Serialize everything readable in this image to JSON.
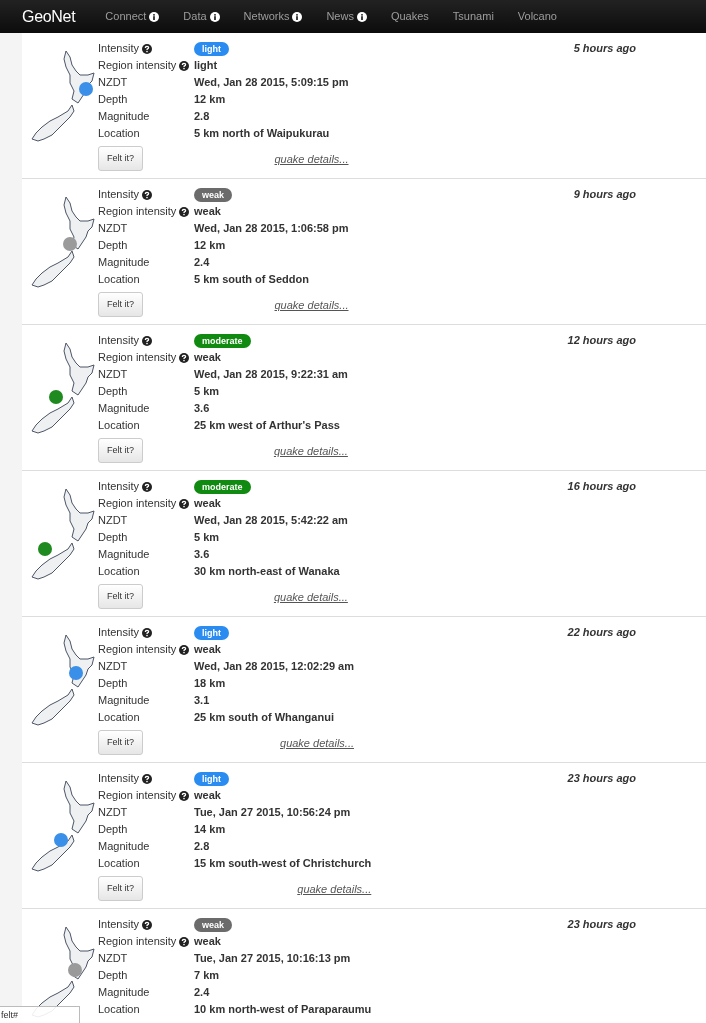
{
  "navbar": {
    "brand": "GeoNet",
    "items": [
      {
        "label": "Connect",
        "info": true
      },
      {
        "label": "Data",
        "info": true
      },
      {
        "label": "Networks",
        "info": true
      },
      {
        "label": "News",
        "info": true
      },
      {
        "label": "Quakes",
        "info": false
      },
      {
        "label": "Tsunami",
        "info": false
      },
      {
        "label": "Volcano",
        "info": false
      }
    ]
  },
  "quakes": [
    {
      "time_ago": "5 hours ago",
      "marker": {
        "color": "#3a8fe8"
      },
      "fields": [
        {
          "label": "Intensity",
          "help": true,
          "kind": "badge",
          "value": "light",
          "color": "#2a8cf0"
        },
        {
          "label": "Region intensity",
          "help": true,
          "kind": "text",
          "value": "light"
        },
        {
          "label": "NZDT",
          "help": false,
          "kind": "text",
          "value": "Wed, Jan 28 2015, 5:09:15 pm"
        },
        {
          "label": "Depth",
          "help": false,
          "kind": "text",
          "value": "12 km"
        },
        {
          "label": "Magnitude",
          "help": false,
          "kind": "text",
          "value": "2.8"
        },
        {
          "label": "Location",
          "help": false,
          "kind": "text",
          "value": "5 km north of Waipukurau"
        }
      ],
      "felt_button": "Felt it?",
      "details_link": "quake details..."
    },
    {
      "time_ago": "9 hours ago",
      "marker": {
        "color": "#9a9a9a"
      },
      "fields": [
        {
          "label": "Intensity",
          "help": true,
          "kind": "badge",
          "value": "weak",
          "color": "#6b6b6b"
        },
        {
          "label": "Region intensity",
          "help": true,
          "kind": "text",
          "value": "weak"
        },
        {
          "label": "NZDT",
          "help": false,
          "kind": "text",
          "value": "Wed, Jan 28 2015, 1:06:58 pm"
        },
        {
          "label": "Depth",
          "help": false,
          "kind": "text",
          "value": "12 km"
        },
        {
          "label": "Magnitude",
          "help": false,
          "kind": "text",
          "value": "2.4"
        },
        {
          "label": "Location",
          "help": false,
          "kind": "text",
          "value": "5 km south of Seddon"
        }
      ],
      "felt_button": "Felt it?",
      "details_link": "quake details..."
    },
    {
      "time_ago": "12 hours ago",
      "marker": {
        "color": "#1f8a1f"
      },
      "fields": [
        {
          "label": "Intensity",
          "help": true,
          "kind": "badge",
          "value": "moderate",
          "color": "#108a10"
        },
        {
          "label": "Region intensity",
          "help": true,
          "kind": "text",
          "value": "weak"
        },
        {
          "label": "NZDT",
          "help": false,
          "kind": "text",
          "value": "Wed, Jan 28 2015, 9:22:31 am"
        },
        {
          "label": "Depth",
          "help": false,
          "kind": "text",
          "value": "5 km"
        },
        {
          "label": "Magnitude",
          "help": false,
          "kind": "text",
          "value": "3.6"
        },
        {
          "label": "Location",
          "help": false,
          "kind": "text",
          "value": "25 km west of Arthur's Pass"
        }
      ],
      "felt_button": "Felt it?",
      "details_link": "quake details..."
    },
    {
      "time_ago": "16 hours ago",
      "marker": {
        "color": "#1f8a1f"
      },
      "fields": [
        {
          "label": "Intensity",
          "help": true,
          "kind": "badge",
          "value": "moderate",
          "color": "#108a10"
        },
        {
          "label": "Region intensity",
          "help": true,
          "kind": "text",
          "value": "weak"
        },
        {
          "label": "NZDT",
          "help": false,
          "kind": "text",
          "value": "Wed, Jan 28 2015, 5:42:22 am"
        },
        {
          "label": "Depth",
          "help": false,
          "kind": "text",
          "value": "5 km"
        },
        {
          "label": "Magnitude",
          "help": false,
          "kind": "text",
          "value": "3.6"
        },
        {
          "label": "Location",
          "help": false,
          "kind": "text",
          "value": "30 km north-east of Wanaka"
        }
      ],
      "felt_button": "Felt it?",
      "details_link": "quake details..."
    },
    {
      "time_ago": "22 hours ago",
      "marker": {
        "color": "#3a8fe8"
      },
      "fields": [
        {
          "label": "Intensity",
          "help": true,
          "kind": "badge",
          "value": "light",
          "color": "#2a8cf0"
        },
        {
          "label": "Region intensity",
          "help": true,
          "kind": "text",
          "value": "weak"
        },
        {
          "label": "NZDT",
          "help": false,
          "kind": "text",
          "value": "Wed, Jan 28 2015, 12:02:29 am"
        },
        {
          "label": "Depth",
          "help": false,
          "kind": "text",
          "value": "18 km"
        },
        {
          "label": "Magnitude",
          "help": false,
          "kind": "text",
          "value": "3.1"
        },
        {
          "label": "Location",
          "help": false,
          "kind": "text",
          "value": "25 km south of Whanganui"
        }
      ],
      "felt_button": "Felt it?",
      "details_link": "quake details..."
    },
    {
      "time_ago": "23 hours ago",
      "marker": {
        "color": "#3a8fe8"
      },
      "fields": [
        {
          "label": "Intensity",
          "help": true,
          "kind": "badge",
          "value": "light",
          "color": "#2a8cf0"
        },
        {
          "label": "Region intensity",
          "help": true,
          "kind": "text",
          "value": "weak"
        },
        {
          "label": "NZDT",
          "help": false,
          "kind": "text",
          "value": "Tue, Jan 27 2015, 10:56:24 pm"
        },
        {
          "label": "Depth",
          "help": false,
          "kind": "text",
          "value": "14 km"
        },
        {
          "label": "Magnitude",
          "help": false,
          "kind": "text",
          "value": "2.8"
        },
        {
          "label": "Location",
          "help": false,
          "kind": "text",
          "value": "15 km south-west of Christchurch"
        }
      ],
      "felt_button": "Felt it?",
      "details_link": "quake details..."
    },
    {
      "time_ago": "23 hours ago",
      "marker": {
        "color": "#9a9a9a"
      },
      "fields": [
        {
          "label": "Intensity",
          "help": true,
          "kind": "badge",
          "value": "weak",
          "color": "#6b6b6b"
        },
        {
          "label": "Region intensity",
          "help": true,
          "kind": "text",
          "value": "weak"
        },
        {
          "label": "NZDT",
          "help": false,
          "kind": "text",
          "value": "Tue, Jan 27 2015, 10:16:13 pm"
        },
        {
          "label": "Depth",
          "help": false,
          "kind": "text",
          "value": "7 km"
        },
        {
          "label": "Magnitude",
          "help": false,
          "kind": "text",
          "value": "2.4"
        },
        {
          "label": "Location",
          "help": false,
          "kind": "text",
          "value": "10 km north-west of Paraparaumu"
        }
      ]
    }
  ],
  "status_url": "felt#"
}
